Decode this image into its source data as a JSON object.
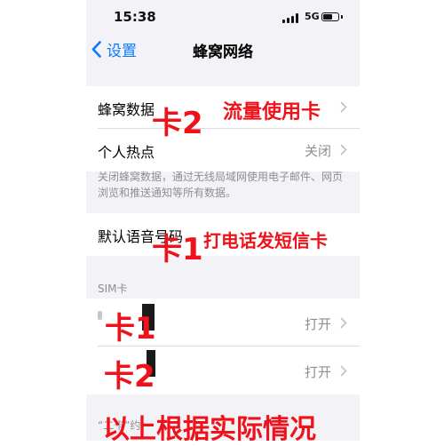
{
  "status_bar": {
    "time": "15:38",
    "network": "5G",
    "battery_level": 0.65
  },
  "nav": {
    "back_label": "设置",
    "title": "蜂窝网络"
  },
  "main_group": {
    "rows": [
      {
        "label": "蜂窝数据",
        "value": ""
      },
      {
        "label": "个人热点",
        "value": "关闭"
      }
    ],
    "footer": "关闭蜂窝数据，通过无线局域网使用电子邮件、网页浏览和推送通知等所有数据。"
  },
  "voice_row": {
    "label": "默认语音号码"
  },
  "sim": {
    "header": "SIM卡",
    "rows": [
      {
        "value": "打开"
      },
      {
        "value": "打开"
      }
    ]
  },
  "bottom_text": "“二卡”约",
  "annotations": {
    "card2_a": "卡2",
    "data_note": "流量使用卡",
    "card1_a": "卡1",
    "call_note": "打电话发短信卡",
    "card1_b": "卡1",
    "card2_b": "卡2",
    "bottom_note": "以上根据实际情况"
  },
  "colors": {
    "accent": "#0a7aff",
    "annotation": "#f0121a",
    "background": "#f2f2f7"
  }
}
